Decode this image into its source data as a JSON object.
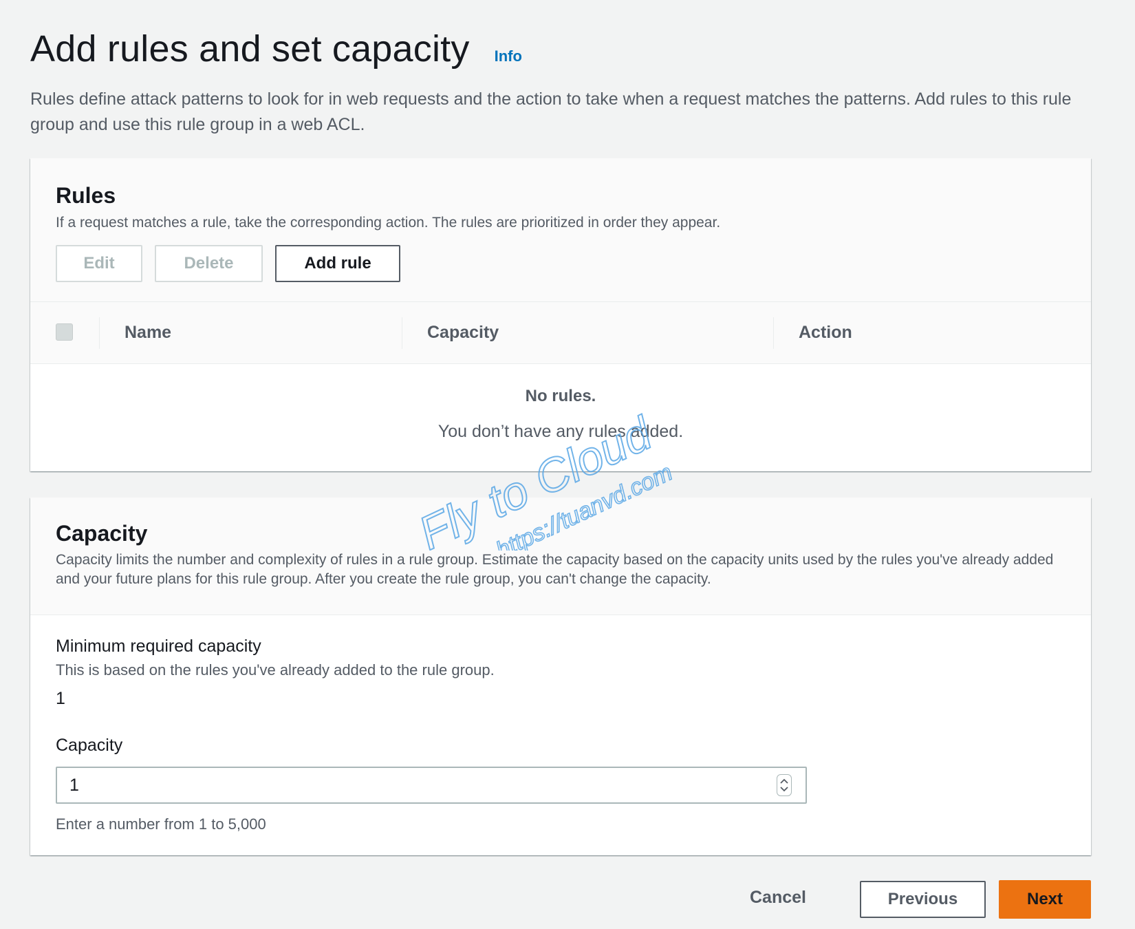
{
  "page": {
    "title": "Add rules and set capacity",
    "info_link": "Info",
    "description": "Rules define attack patterns to look for in web requests and the action to take when a request matches the patterns. Add rules to this rule group and use this rule group in a web ACL."
  },
  "rules": {
    "title": "Rules",
    "description": "If a request matches a rule, take the corresponding action. The rules are prioritized in order they appear.",
    "buttons": {
      "edit": "Edit",
      "delete": "Delete",
      "add": "Add rule"
    },
    "columns": [
      "Name",
      "Capacity",
      "Action"
    ],
    "empty_title": "No rules.",
    "empty_description": "You don’t have any rules added."
  },
  "capacity": {
    "title": "Capacity",
    "description": "Capacity limits the number and complexity of rules in a rule group. Estimate the capacity based on the capacity units used by the rules you've already added and your future plans for this rule group. After you create the rule group, you can't change the capacity.",
    "min_label": "Minimum required capacity",
    "min_description": "This is based on the rules you've already added to the rule group.",
    "min_value": "1",
    "field_label": "Capacity",
    "field_value": "1",
    "field_hint": "Enter a number from 1 to 5,000"
  },
  "footer": {
    "cancel": "Cancel",
    "previous": "Previous",
    "next": "Next"
  },
  "watermark": {
    "line1": "Fly to Cloud",
    "line2": "https://tuanvd.com"
  },
  "colors": {
    "accent": "#ec7211",
    "link": "#0073bb",
    "background": "#f2f3f3",
    "watermark": "#5aa7e6"
  }
}
